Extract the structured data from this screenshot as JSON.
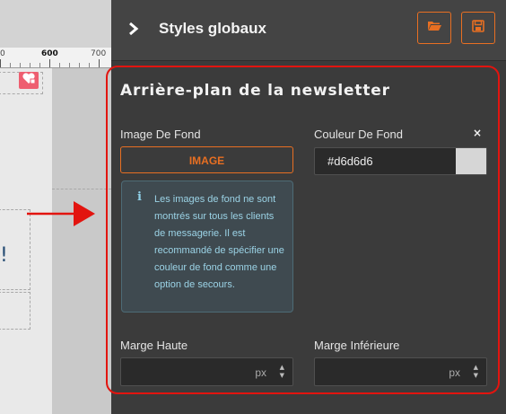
{
  "ruler": {
    "marks": [
      "0",
      "600",
      "700"
    ]
  },
  "canvas": {
    "text_fragment": "!"
  },
  "header": {
    "title": "Styles globaux"
  },
  "section": {
    "title": "Arrière-plan de la newsletter"
  },
  "background_image": {
    "label": "Image De Fond",
    "button_label": "IMAGE"
  },
  "background_color": {
    "label": "Couleur De Fond",
    "clear_label": "×",
    "value": "#d6d6d6"
  },
  "info_message": "Les images de fond ne sont montrés sur tous les clients de messagerie. Il est recommandé de spécifier une couleur de fond comme une option de secours.",
  "margin_top": {
    "label": "Marge Haute",
    "unit": "px",
    "value": ""
  },
  "margin_bottom": {
    "label": "Marge Inférieure",
    "unit": "px",
    "value": ""
  },
  "colors": {
    "accent": "#e86f22",
    "highlight": "#e2140f",
    "panel_bg": "#3b3b3b",
    "info_text": "#9bd3e6"
  },
  "icons": [
    "chevron-right-icon",
    "folder-open-icon",
    "save-icon",
    "info-icon",
    "arrow-right-icon",
    "heart-badge-icon"
  ]
}
